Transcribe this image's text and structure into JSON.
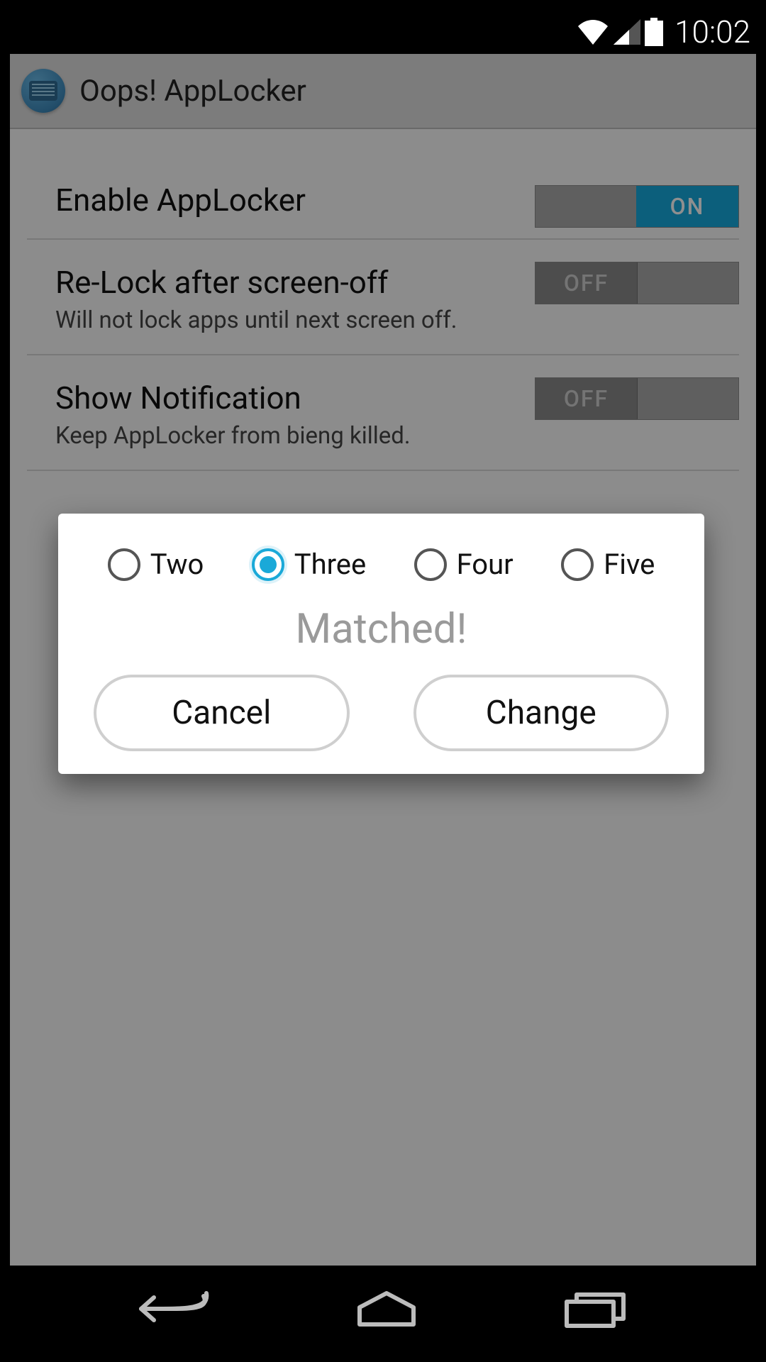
{
  "status": {
    "time": "10:02"
  },
  "header": {
    "title": "Oops! AppLocker"
  },
  "rows": [
    {
      "title": "Enable AppLocker",
      "sub": "",
      "toggle": "ON",
      "on": true
    },
    {
      "title": "Re-Lock after screen-off",
      "sub": "Will not lock apps until next screen off.",
      "toggle": "OFF",
      "on": false
    },
    {
      "title": "Show Notification",
      "sub": "Keep AppLocker from bieng killed.",
      "toggle": "OFF",
      "on": false
    }
  ],
  "dialog": {
    "options": [
      {
        "label": "Two",
        "selected": false
      },
      {
        "label": "Three",
        "selected": true
      },
      {
        "label": "Four",
        "selected": false
      },
      {
        "label": "Five",
        "selected": false
      }
    ],
    "status_text": "Matched!",
    "cancel": "Cancel",
    "change": "Change"
  }
}
